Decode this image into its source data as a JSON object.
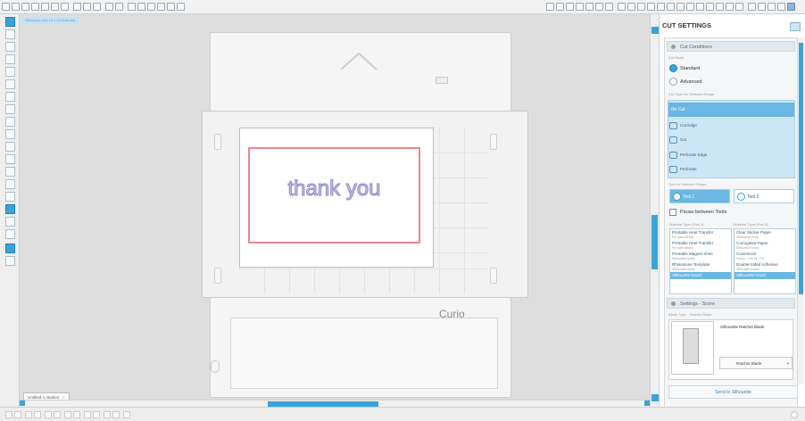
{
  "canvas": {
    "document_tab": "Silhouette Mat 12 x 12 (Cameo)",
    "file_tab": "Untitled-1.studio3",
    "file_tab_close": "x",
    "design_text": "thank you",
    "machine_logo": "Curio"
  },
  "panel": {
    "title": "CUT SETTINGS",
    "cut_conditions": {
      "header": "Cut Conditions",
      "cut_mode_label": "Cut Mode",
      "modes": [
        {
          "label": "Standard",
          "selected": true
        },
        {
          "label": "Advanced",
          "selected": false
        }
      ],
      "cut_style_label": "Cut Style for Selected Shape",
      "cut_styles": [
        "No Cut",
        "Cut Edge",
        "Cut",
        "Perforate Edge",
        "Perforate"
      ],
      "tool_label": "Tool for Selected Shape",
      "tools": [
        "Tool 1",
        "Tool 2"
      ],
      "pause_label": "Pause between Tools"
    },
    "materials": {
      "tool1_header": "Material Type (Tool 1)",
      "tool2_header": "Material Type (Tool 2)",
      "tool1_items": [
        {
          "name": "Printable Heat Transfer",
          "sub": "For dark fabrics"
        },
        {
          "name": "Printable Heat Transfer",
          "sub": "For light fabrics"
        },
        {
          "name": "Printable Magnet Shee",
          "sub": "Silhouette brand"
        },
        {
          "name": "Rhinestone Template",
          "sub": "Silhouette brand"
        },
        {
          "name": "Silhouette brand",
          "sub": ""
        }
      ],
      "tool2_items": [
        {
          "name": "Clear Sticker Paper",
          "sub": "Silhouette brand"
        },
        {
          "name": "Corrugated Paper",
          "sub": "Silhouette brand"
        },
        {
          "name": "Coverstock",
          "sub": "Heavy - 100 lb / 270"
        },
        {
          "name": "Double-Sided Adhesive",
          "sub": "Silhouette brand"
        },
        {
          "name": "Silhouette brand",
          "sub": ""
        }
      ],
      "add": "+",
      "remove": "-"
    },
    "settings": {
      "header": "Settings - Score",
      "blade_label": "Blade Type - Ratchet Blade",
      "blade_name": "Silhouette Ratchet Blade",
      "blade_select": "Ratchet Blade"
    },
    "send_button": "Send to Silhouette"
  },
  "colors": {
    "accent": "#3aa3d9",
    "cut_line": "#e8888a",
    "text_fill": "#c9c4e8"
  }
}
